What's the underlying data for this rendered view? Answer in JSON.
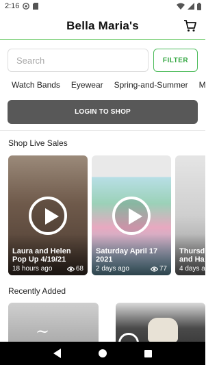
{
  "status_bar": {
    "time": "2:16"
  },
  "header": {
    "title": "Bella Maria's"
  },
  "search": {
    "placeholder": "Search",
    "filter_label": "FILTER"
  },
  "categories": [
    "Watch Bands",
    "Eyewear",
    "Spring-and-Summer",
    "M"
  ],
  "login_label": "LOGIN TO SHOP",
  "live_sales": {
    "title": "Shop Live Sales",
    "cards": [
      {
        "title": "Laura and Helen Pop Up 4/19/21",
        "age": "18 hours ago",
        "views": "68"
      },
      {
        "title": "Saturday  April 17 2021",
        "age": "2 days ago",
        "views": "77"
      },
      {
        "title": "Thursd and Ha",
        "age": "4 days a",
        "views": ""
      }
    ]
  },
  "recently_added": {
    "title": "Recently Added"
  },
  "colors": {
    "accent_green": "#31a63f",
    "header_border": "#7ed17a",
    "login_bg": "#585858"
  }
}
